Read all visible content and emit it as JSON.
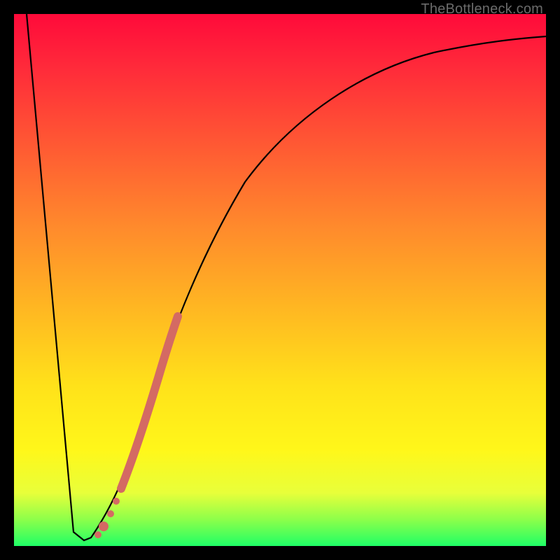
{
  "watermark": "TheBottleneck.com",
  "colors": {
    "curve": "#000000",
    "marker": "#d46a63",
    "frame": "#000000"
  },
  "chart_data": {
    "type": "line",
    "title": "",
    "xlabel": "",
    "ylabel": "",
    "xlim": [
      0,
      100
    ],
    "ylim": [
      0,
      100
    ],
    "grid": false,
    "series": [
      {
        "name": "curve",
        "x": [
          0,
          5,
          10,
          11,
          12,
          15,
          20,
          25,
          30,
          40,
          50,
          60,
          70,
          80,
          90,
          100
        ],
        "y": [
          100,
          50,
          0,
          0,
          0,
          6,
          22,
          38,
          52,
          70,
          80,
          86,
          90,
          92.5,
          94,
          95
        ]
      }
    ],
    "markers": [
      {
        "name": "highlight-segment",
        "x_range": [
          20,
          28
        ],
        "style": "thick-pink"
      },
      {
        "name": "dot-a",
        "x": 19,
        "y": 18,
        "r": 4
      },
      {
        "name": "dot-b",
        "x": 17,
        "y": 12,
        "r": 4
      },
      {
        "name": "dot-c",
        "x": 15,
        "y": 6,
        "r": 5
      },
      {
        "name": "dot-d",
        "x": 14,
        "y": 3,
        "r": 4
      }
    ]
  }
}
